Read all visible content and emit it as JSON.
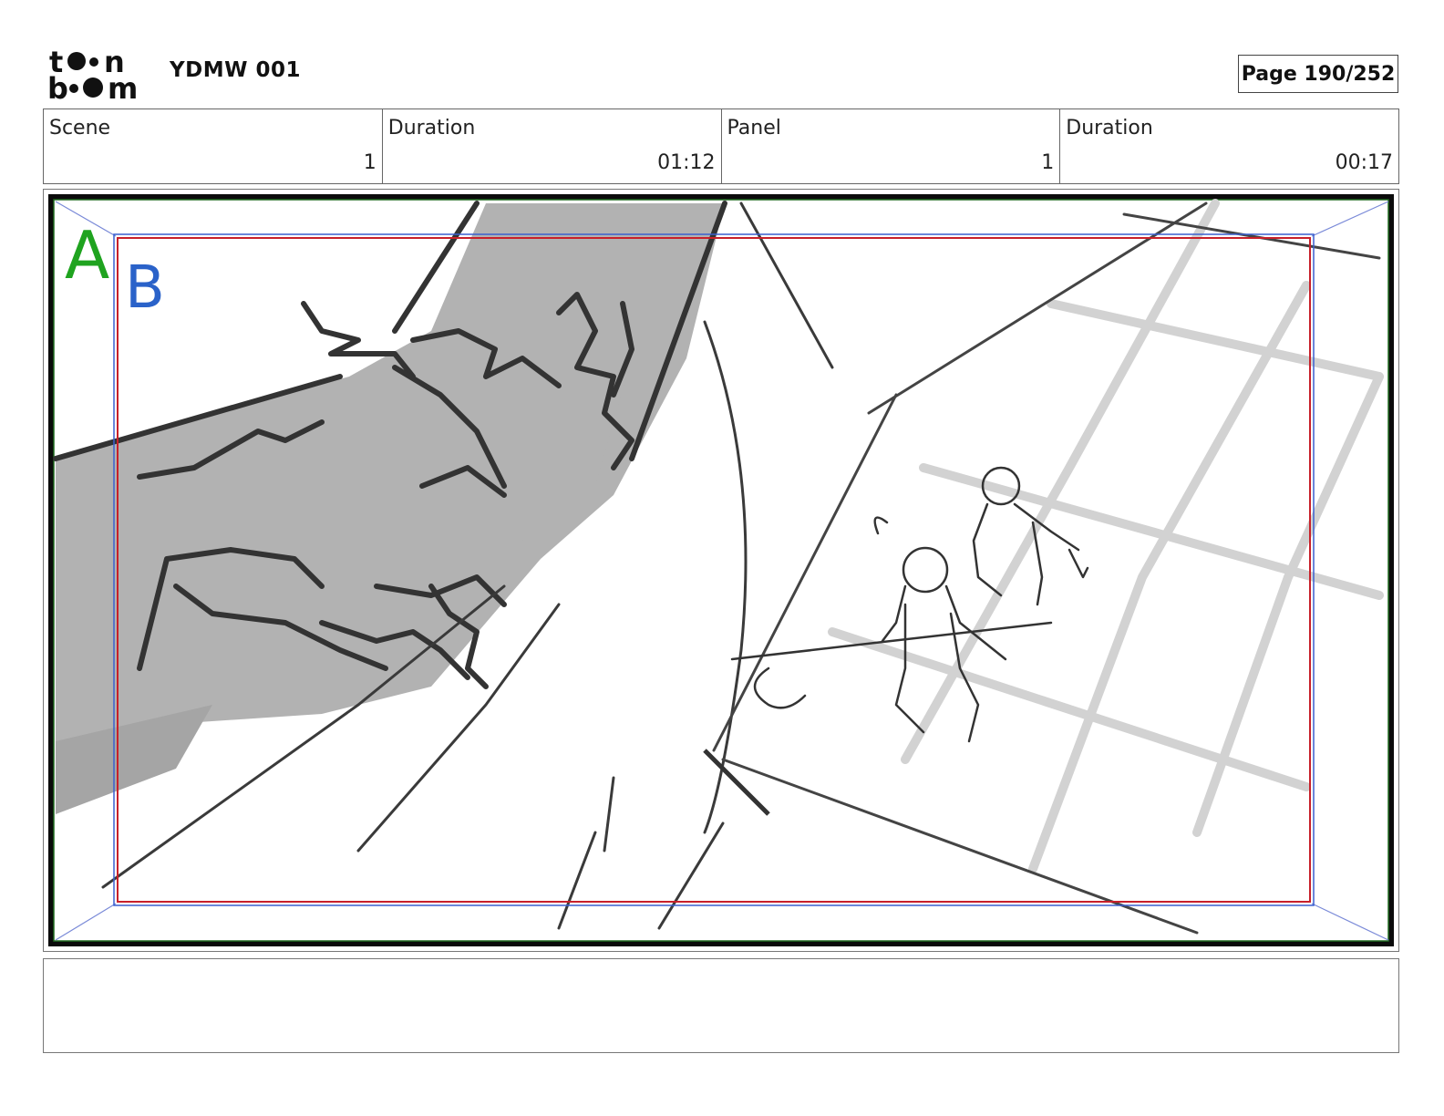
{
  "header": {
    "logo_name": "toon boom",
    "project_title": "YDMW 001",
    "page_label": "Page 190/252"
  },
  "info": {
    "scene_label": "Scene",
    "scene_value": "1",
    "scene_duration_label": "Duration",
    "scene_duration_value": "01:12",
    "panel_label": "Panel",
    "panel_value": "1",
    "panel_duration_label": "Duration",
    "panel_duration_value": "00:17"
  },
  "panel": {
    "frame_a_label": "A",
    "frame_b_label": "B",
    "frame_a_color": "#1fa31f",
    "frame_b_color": "#2a62c9",
    "safe_area_color": "#c8202a"
  },
  "notes": {
    "text": ""
  }
}
